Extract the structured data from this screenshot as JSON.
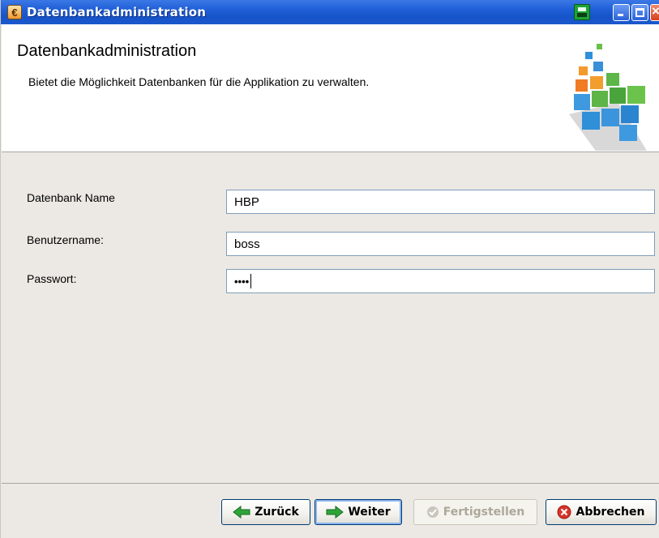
{
  "window": {
    "title": "Datenbankadministration",
    "icons": [
      "app-icon",
      "print-icon",
      "minimize-icon",
      "maximize-icon",
      "close-icon"
    ]
  },
  "header": {
    "title": "Datenbankadministration",
    "description": "Bietet die Möglichkeit Datenbanken für die Applikation zu verwalten.",
    "logo": "database-cubes-logo"
  },
  "form": {
    "db_name_label": "Datenbank Name",
    "db_name_value": "HBP",
    "username_label": "Benutzername:",
    "username_value": "boss",
    "password_label": "Passwort:",
    "password_masked": "••••"
  },
  "buttons": {
    "back": "Zurück",
    "next": "Weiter",
    "finish": "Fertigstellen",
    "cancel": "Abbrechen"
  },
  "colors": {
    "titlebar": "#1f5fd7",
    "next_arrow": "#2ea43a",
    "cancel_icon": "#d9342b"
  }
}
